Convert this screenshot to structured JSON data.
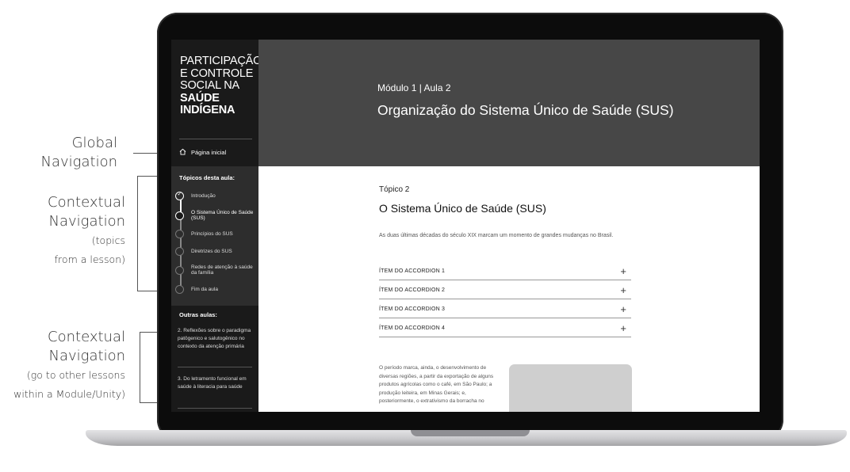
{
  "annotations": {
    "global": [
      "Global",
      "Navigation"
    ],
    "contextual_topics": [
      "Contextual",
      "Navigation",
      "(topics",
      "from a lesson)"
    ],
    "contextual_lessons": [
      "Contextual",
      "Navigation",
      "(go to other lessons",
      "within a Module/Unity)"
    ]
  },
  "sidebar": {
    "course_title": [
      "PARTICIPAÇÃO",
      "E CONTROLE",
      "SOCIAL NA"
    ],
    "course_title_bold": [
      "SAÚDE",
      "INDÍGENA"
    ],
    "home_label": "Página inicial",
    "topics_title": "Tópicos desta aula:",
    "topics": [
      {
        "label": "Introdução",
        "state": "done"
      },
      {
        "label": "O Sistema Único de Saúde (SUS)",
        "state": "active"
      },
      {
        "label": "Princípios do SUS",
        "state": "pending"
      },
      {
        "label": "Diretrizes do SUS",
        "state": "pending"
      },
      {
        "label": "Redes de atenção à saúde da família",
        "state": "pending"
      },
      {
        "label": "Fim da aula",
        "state": "pending"
      }
    ],
    "other_title": "Outras aulas:",
    "other_lessons": [
      "2. Reflexões sobre o paradigma patôgenico e salutogênico no contexto da atenção primária",
      "3. Do letramento funcional em saúde à literacia para saúde"
    ]
  },
  "header": {
    "module": "Módulo 1 | Aula 2",
    "title": "Organização do Sistema Único de Saúde (SUS)"
  },
  "content": {
    "topic_number": "Tópico 2",
    "topic_title": "O Sistema Único de Saúde (SUS)",
    "intro": "As duas últimas décadas do século XIX marcam um momento de grandes mudanças no Brasil.",
    "accordions": [
      "ÍTEM DO ACCORDION 1",
      "ÍTEM DO ACCORDION 2",
      "ÍTEM DO ACCORDION 3",
      "ÍTEM DO ACCORDION 4"
    ],
    "accordion_icon": "+",
    "paragraph": "O período marca, ainda, o desenvolvimento de diversas regiões, a partir da exportação de alguns produtos agrícolas como o café, em São Paulo; a produção leiteira, em Minas Gerais; e, posteriormente, o extrativismo da borracha no"
  },
  "icons": {
    "home": "home-icon",
    "check": "check-icon",
    "plus": "plus-icon"
  }
}
